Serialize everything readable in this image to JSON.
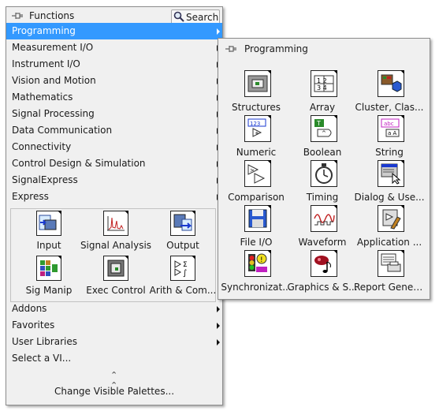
{
  "functions": {
    "title": "Functions",
    "search_label": "Search",
    "menu": [
      {
        "label": "Programming",
        "selected": true
      },
      {
        "label": "Measurement I/O"
      },
      {
        "label": "Instrument I/O"
      },
      {
        "label": "Vision and Motion"
      },
      {
        "label": "Mathematics"
      },
      {
        "label": "Signal Processing"
      },
      {
        "label": "Data Communication"
      },
      {
        "label": "Connectivity"
      },
      {
        "label": "Control Design & Simulation"
      },
      {
        "label": "SignalExpress"
      },
      {
        "label": "Express"
      }
    ],
    "express_tiles": [
      {
        "label": "Input",
        "icon": "input-icon"
      },
      {
        "label": "Signal Analysis",
        "icon": "signal-analysis-icon"
      },
      {
        "label": "Output",
        "icon": "output-icon"
      },
      {
        "label": "Sig Manip",
        "icon": "sig-manip-icon"
      },
      {
        "label": "Exec Control",
        "icon": "exec-control-icon"
      },
      {
        "label": "Arith & Com...",
        "icon": "arith-comparison-icon"
      }
    ],
    "bottom_menu": [
      {
        "label": "Addons",
        "submenu": true
      },
      {
        "label": "Favorites",
        "submenu": true
      },
      {
        "label": "User Libraries",
        "submenu": true
      },
      {
        "label": "Select a VI...",
        "submenu": false
      }
    ],
    "change_palettes": "Change Visible Palettes..."
  },
  "programming": {
    "title": "Programming",
    "tiles": [
      {
        "label": "Structures",
        "icon": "structures-icon"
      },
      {
        "label": "Array",
        "icon": "array-icon"
      },
      {
        "label": "Cluster, Clas...",
        "icon": "cluster-class-icon"
      },
      {
        "label": "Numeric",
        "icon": "numeric-icon"
      },
      {
        "label": "Boolean",
        "icon": "boolean-icon"
      },
      {
        "label": "String",
        "icon": "string-icon"
      },
      {
        "label": "Comparison",
        "icon": "comparison-icon"
      },
      {
        "label": "Timing",
        "icon": "timing-icon"
      },
      {
        "label": "Dialog & Use...",
        "icon": "dialog-user-interface-icon"
      },
      {
        "label": "File I/O",
        "icon": "file-io-icon"
      },
      {
        "label": "Waveform",
        "icon": "waveform-icon"
      },
      {
        "label": "Application ...",
        "icon": "application-control-icon"
      },
      {
        "label": "Synchronizat...",
        "icon": "synchronization-icon"
      },
      {
        "label": "Graphics & S...",
        "icon": "graphics-sound-icon"
      },
      {
        "label": "Report Gener...",
        "icon": "report-generation-icon"
      }
    ]
  },
  "colors": {
    "selection": "#3399ff",
    "palette_bg": "#f0f0f0"
  }
}
